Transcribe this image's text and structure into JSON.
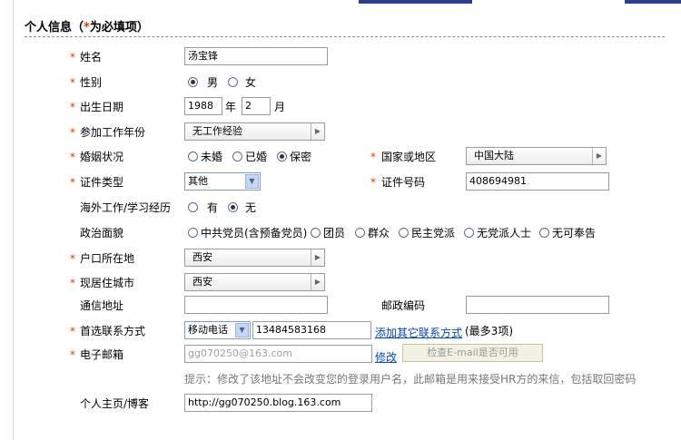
{
  "section_title": {
    "main": "个人信息（",
    "star": "*",
    "suffix": "为必填项）"
  },
  "fields": {
    "name": {
      "label": "姓名",
      "value": "汤宝锋"
    },
    "gender": {
      "label": "性别",
      "male": "男",
      "female": "女",
      "selected": "male"
    },
    "birth": {
      "label": "出生日期",
      "year": "1988",
      "year_unit": "年",
      "month": "2",
      "month_unit": "月"
    },
    "work_years": {
      "label": "参加工作年份",
      "value": "无工作经验"
    },
    "marital": {
      "label": "婚姻状况",
      "options": [
        "未婚",
        "已婚",
        "保密"
      ],
      "selected": "保密"
    },
    "country": {
      "label": "国家或地区",
      "value": "中国大陆"
    },
    "id_type": {
      "label": "证件类型",
      "value": "其他"
    },
    "id_number": {
      "label": "证件号码",
      "value": "408694981"
    },
    "overseas": {
      "label": "海外工作/学习经历",
      "yes": "有",
      "no": "无",
      "selected": "no"
    },
    "political": {
      "label": "政治面貌",
      "options": [
        "中共党员(含预备党员)",
        "团员",
        "群众",
        "民主党派",
        "无党派人士",
        "无可奉告"
      ]
    },
    "hukou": {
      "label": "户口所在地",
      "value": "西安"
    },
    "city": {
      "label": "现居住城市",
      "value": "西安"
    },
    "address": {
      "label": "通信地址",
      "value": ""
    },
    "postcode": {
      "label": "邮政编码",
      "value": ""
    },
    "contact": {
      "label": "首选联系方式",
      "type": "移动电话",
      "value": "13484583168",
      "add_link": "添加其它联系方式",
      "note": "(最多3项)"
    },
    "email": {
      "label": "电子邮箱",
      "value": "gg070250@163.com",
      "modify": "修改",
      "check_btn": "检查E-mail是否可用"
    },
    "hint": "提示：修改了该地址不会改变您的登录用户名，此邮箱是用来接受HR方的来信，包括取回密码",
    "homepage": {
      "label": "个人主页/博客",
      "value": "http://gg070250.blog.163.com"
    }
  },
  "required_mark": "*"
}
